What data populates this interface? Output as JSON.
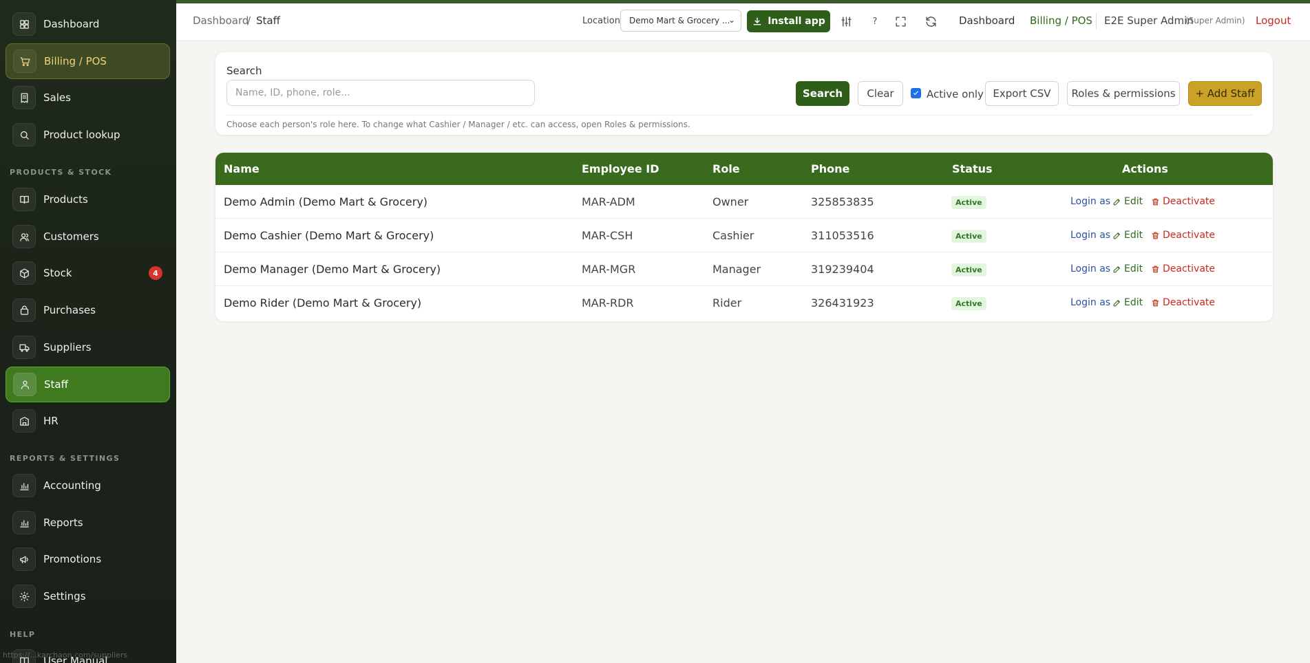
{
  "sidebar": {
    "items": [
      {
        "label": "Dashboard"
      },
      {
        "label": "Billing / POS"
      },
      {
        "label": "Sales"
      },
      {
        "label": "Product lookup"
      },
      {
        "label": "Products"
      },
      {
        "label": "Customers"
      },
      {
        "label": "Stock",
        "badge": "4"
      },
      {
        "label": "Purchases"
      },
      {
        "label": "Suppliers"
      },
      {
        "label": "Staff"
      },
      {
        "label": "HR"
      },
      {
        "label": "Accounting"
      },
      {
        "label": "Reports"
      },
      {
        "label": "Promotions"
      },
      {
        "label": "Settings"
      },
      {
        "label": "User Manual"
      }
    ],
    "sections": {
      "products_stock": "PRODUCTS & STOCK",
      "reports_settings": "REPORTS & SETTINGS",
      "help": "HELP"
    },
    "status_url": "https://...karchaon.com/suppliers"
  },
  "topbar": {
    "breadcrumb_root": "Dashboard",
    "breadcrumb_sep": "/",
    "breadcrumb_current": "Staff",
    "location_label": "Location",
    "location_value": "Demo Mart & Grocery ...",
    "install_label": "Install app",
    "help_glyph": "?",
    "dashboard_link": "Dashboard",
    "billing_link": "Billing / POS",
    "user_name": "E2E Super Admin",
    "user_role": "(Super Admin)",
    "logout_label": "Logout"
  },
  "search": {
    "label": "Search",
    "placeholder": "Name, ID, phone, role...",
    "search_button": "Search",
    "clear_button": "Clear",
    "active_only_label": "Active only",
    "export_button": "Export CSV",
    "roles_button": "Roles & permissions",
    "add_button": "+ Add Staff",
    "hint": "Choose each person's role here. To change what Cashier / Manager / etc. can access, open Roles & permissions."
  },
  "table": {
    "headers": {
      "name": "Name",
      "employee_id": "Employee ID",
      "role": "Role",
      "phone": "Phone",
      "status": "Status",
      "actions": "Actions"
    },
    "rows": [
      {
        "name": "Demo Admin (Demo Mart & Grocery)",
        "employee_id": "MAR-ADM",
        "role": "Owner",
        "phone": "325853835",
        "status": "Active"
      },
      {
        "name": "Demo Cashier (Demo Mart & Grocery)",
        "employee_id": "MAR-CSH",
        "role": "Cashier",
        "phone": "311053516",
        "status": "Active"
      },
      {
        "name": "Demo Manager (Demo Mart & Grocery)",
        "employee_id": "MAR-MGR",
        "role": "Manager",
        "phone": "319239404",
        "status": "Active"
      },
      {
        "name": "Demo Rider (Demo Mart & Grocery)",
        "employee_id": "MAR-RDR",
        "role": "Rider",
        "phone": "326431923",
        "status": "Active"
      }
    ],
    "actions": {
      "login": "Login as",
      "edit": "Edit",
      "deactivate": "Deactivate"
    }
  },
  "colors": {
    "brand_green": "#2f5e1a",
    "header_green": "#3a6a1e",
    "accent_gold": "#c9a227",
    "danger": "#c8281f"
  }
}
